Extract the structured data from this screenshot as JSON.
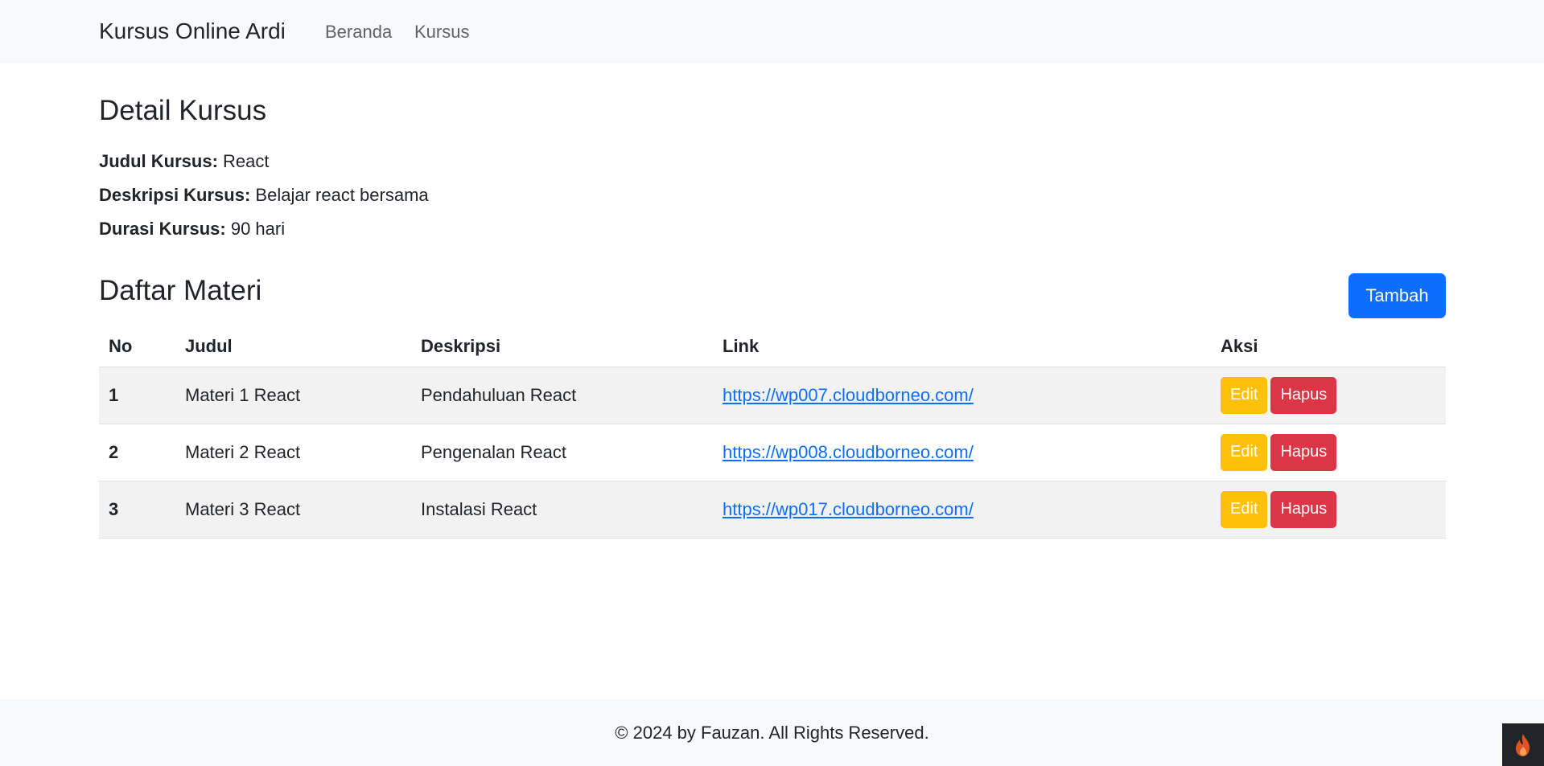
{
  "navbar": {
    "brand": "Kursus Online Ardi",
    "links": [
      {
        "label": "Beranda"
      },
      {
        "label": "Kursus"
      }
    ]
  },
  "detail": {
    "heading": "Detail Kursus",
    "judul_label": "Judul Kursus:",
    "judul_value": "React",
    "deskripsi_label": "Deskripsi Kursus:",
    "deskripsi_value": "Belajar react bersama",
    "durasi_label": "Durasi Kursus:",
    "durasi_value": "90 hari"
  },
  "materi": {
    "heading": "Daftar Materi",
    "add_button": "Tambah",
    "columns": [
      "No",
      "Judul",
      "Deskripsi",
      "Link",
      "Aksi"
    ],
    "rows": [
      {
        "no": "1",
        "judul": "Materi 1 React",
        "deskripsi": "Pendahuluan React",
        "link": "https://wp007.cloudborneo.com/",
        "edit": "Edit",
        "hapus": "Hapus"
      },
      {
        "no": "2",
        "judul": "Materi 2 React",
        "deskripsi": "Pengenalan React",
        "link": "https://wp008.cloudborneo.com/",
        "edit": "Edit",
        "hapus": "Hapus"
      },
      {
        "no": "3",
        "judul": "Materi 3 React",
        "deskripsi": "Instalasi React",
        "link": "https://wp017.cloudborneo.com/",
        "edit": "Edit",
        "hapus": "Hapus"
      }
    ]
  },
  "footer": {
    "text": "© 2024 by Fauzan. All Rights Reserved."
  },
  "colors": {
    "primary": "#0d6efd",
    "warning": "#ffc107",
    "danger": "#dc3545",
    "navbar_bg": "#f8f9fa",
    "stripe": "#f2f2f2"
  },
  "icons": {
    "corner": "flame-icon"
  }
}
